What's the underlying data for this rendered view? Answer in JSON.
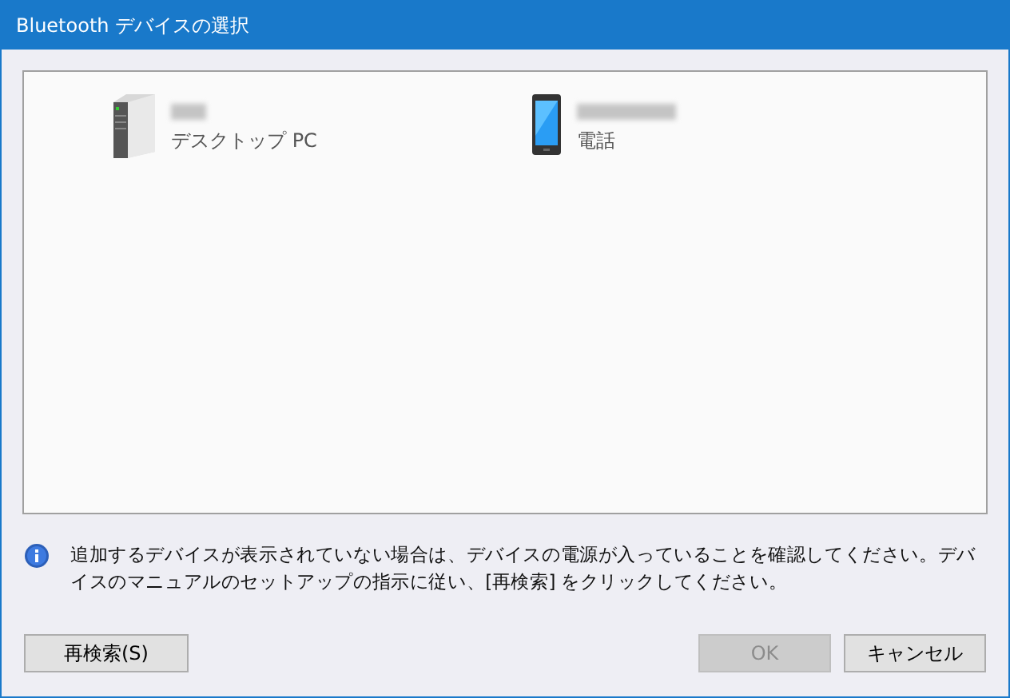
{
  "window": {
    "title": "Bluetooth デバイスの選択"
  },
  "devices": [
    {
      "kind": "desktop",
      "name_blurred": true,
      "type_label": "デスクトップ PC"
    },
    {
      "kind": "phone",
      "name_blurred": true,
      "type_label": "電話"
    }
  ],
  "message": "追加するデバイスが表示されていない場合は、デバイスの電源が入っていることを確認してください。デバイスのマニュアルのセットアップの指示に従い、[再検索] をクリックしてください。",
  "left_buttons": [
    {
      "label": "再検索(S)",
      "disabled": false
    }
  ],
  "right_buttons": [
    {
      "label": "OK",
      "disabled": true
    },
    {
      "label": "キャンセル",
      "disabled": false
    }
  ]
}
